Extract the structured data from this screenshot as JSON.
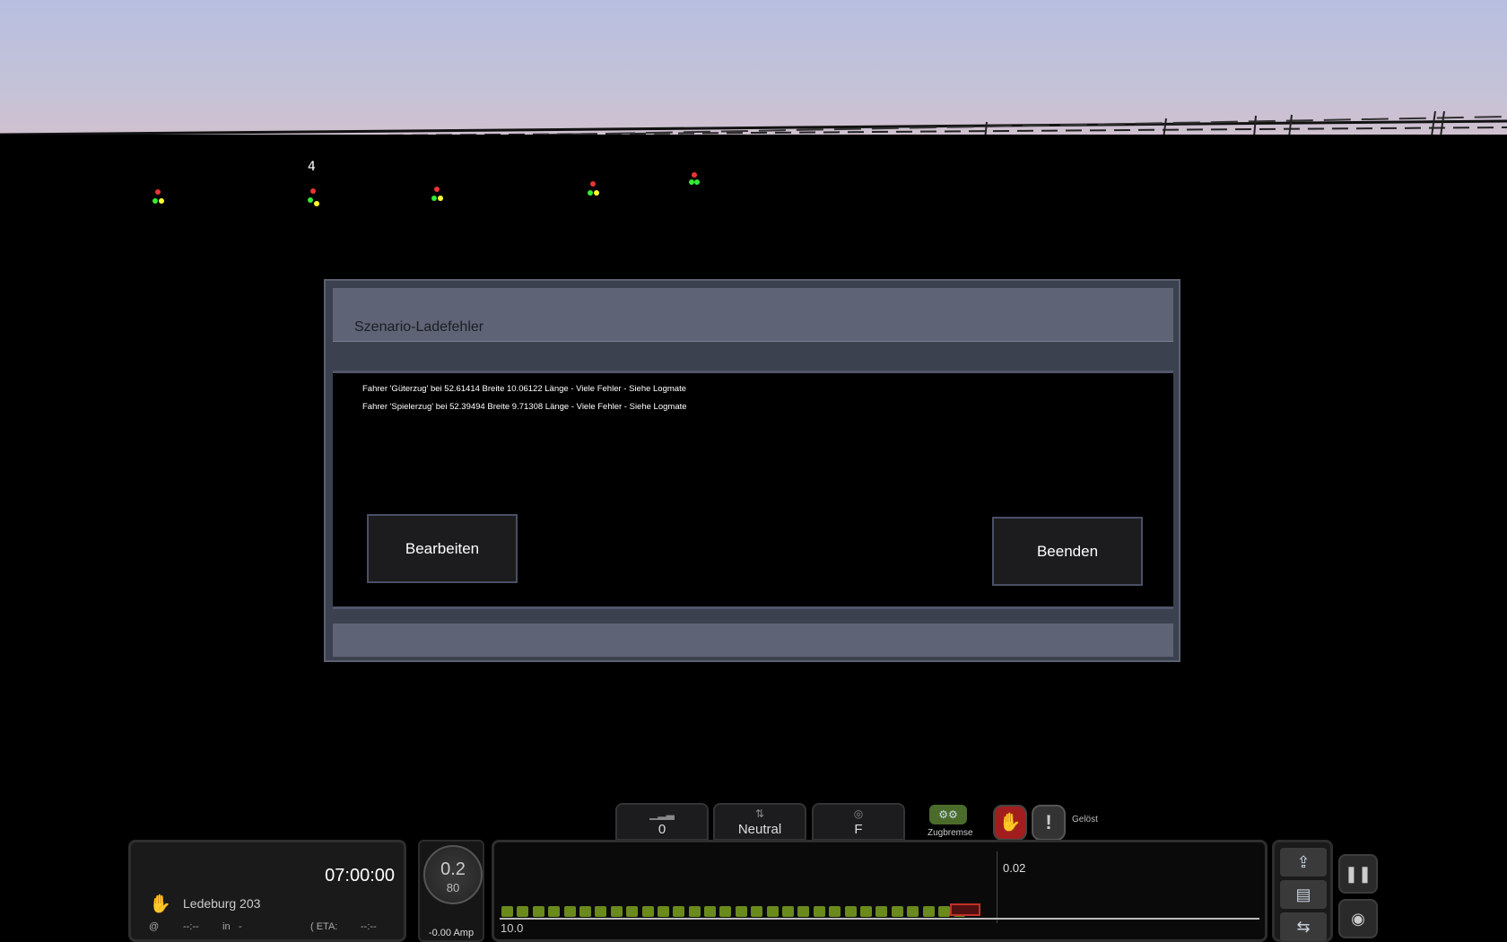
{
  "dialog": {
    "title": "Szenario-Ladefehler",
    "messages": [
      "Fahrer 'Güterzug' bei 52.61414 Breite 10.06122 Länge - Viele Fehler - Siehe Logmate",
      "Fahrer 'Spielerzug' bei 52.39494 Breite 9.71308 Länge - Viele Fehler - Siehe Logmate"
    ],
    "edit_label": "Bearbeiten",
    "quit_label": "Beenden"
  },
  "scene": {
    "signal_number": "4"
  },
  "hud": {
    "throttle_value": "0",
    "reverser_value": "Neutral",
    "mode_value": "F",
    "brake_label": "Zugbremse",
    "brake_state": "Gelöst",
    "time": "07:00:00",
    "location": "Ledeburg 203",
    "at_symbol": "@",
    "at_value": "--:--",
    "in_label": "in",
    "in_value": "-",
    "eta_label": "( ETA:",
    "eta_value": "--:--",
    "speed": "0.2",
    "speed_limit": "80",
    "amperage": "-0.00 Amp",
    "distance": "0.02",
    "scale": "10.0",
    "wagon_count": 30
  },
  "colors": {
    "dialog_bg": "#3c4150",
    "header_bg": "#5e6475",
    "wagon": "#6a8a1c",
    "loco": "#c0302a"
  },
  "icons": [
    "signal-bars-icon",
    "reverser-icon",
    "mode-icon",
    "brake-icon",
    "hand-icon",
    "alert-icon",
    "hand-small-icon",
    "upload-icon",
    "save-icon",
    "couple-icon",
    "pause-icon",
    "camera-icon"
  ]
}
